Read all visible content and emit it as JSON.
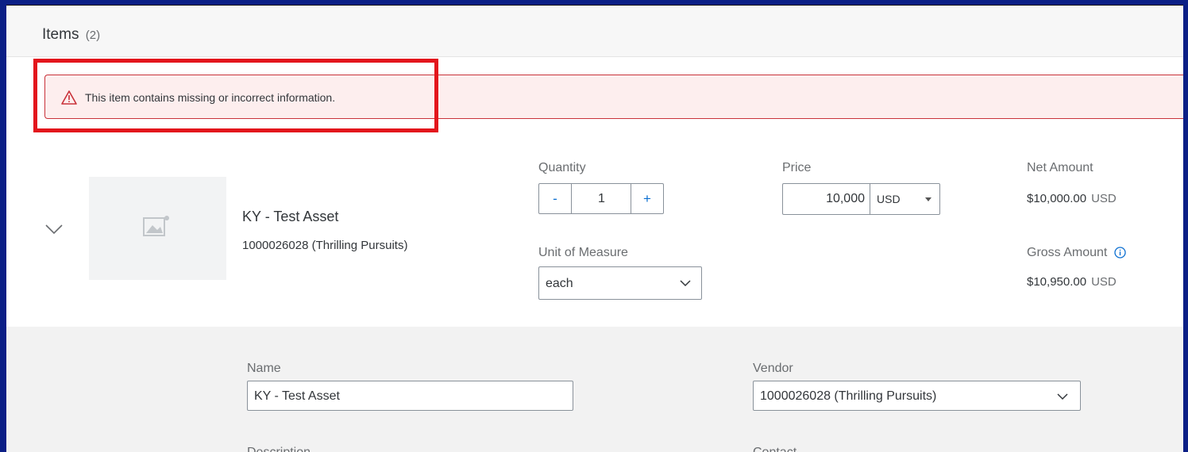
{
  "section": {
    "title": "Items",
    "count": "(2)"
  },
  "alert": {
    "message": "This item contains missing or incorrect information."
  },
  "item": {
    "name": "KY - Test Asset",
    "vendor": "1000026028 (Thrilling Pursuits)",
    "quantity_label": "Quantity",
    "quantity_minus": "-",
    "quantity_value": "1",
    "quantity_plus": "+",
    "uom_label": "Unit of Measure",
    "uom_value": "each",
    "price_label": "Price",
    "price_value": "10,000",
    "price_currency": "USD",
    "net_label": "Net Amount",
    "net_value": "$10,000.00",
    "net_currency": "USD",
    "gross_label": "Gross Amount",
    "gross_value": "$10,950.00",
    "gross_currency": "USD"
  },
  "details": {
    "name_label": "Name",
    "name_value": "KY - Test Asset",
    "vendor_label": "Vendor",
    "vendor_value": "1000026028 (Thrilling Pursuits)",
    "description_label": "Description",
    "contact_label": "Contact"
  },
  "colors": {
    "error": "#e3161c",
    "accent": "#0a6ed1",
    "alert_bg": "#fdeeee"
  },
  "icons": [
    "warning-icon",
    "expand-chevron-icon",
    "image-placeholder-icon",
    "dropdown-chevron-icon",
    "info-icon"
  ]
}
